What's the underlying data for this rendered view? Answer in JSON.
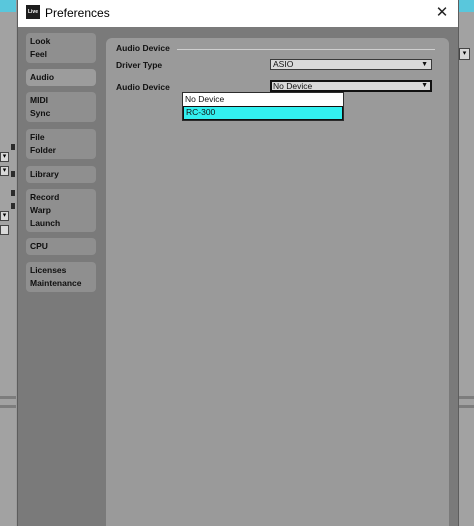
{
  "window": {
    "app_logo": "Live",
    "title": "Preferences",
    "close_glyph": "✕"
  },
  "sidebar": {
    "tabs": [
      {
        "lines": [
          "Look",
          "Feel"
        ],
        "active": false
      },
      {
        "lines": [
          "Audio"
        ],
        "active": true
      },
      {
        "lines": [
          "MIDI",
          "Sync"
        ],
        "active": false
      },
      {
        "lines": [
          "File",
          "Folder"
        ],
        "active": false
      },
      {
        "lines": [
          "Library"
        ],
        "active": false
      },
      {
        "lines": [
          "Record",
          "Warp",
          "Launch"
        ],
        "active": false
      },
      {
        "lines": [
          "CPU"
        ],
        "active": false
      },
      {
        "lines": [
          "Licenses",
          "Maintenance"
        ],
        "active": false
      }
    ]
  },
  "audio": {
    "section_title": "Audio Device",
    "driver_type": {
      "label": "Driver Type",
      "value": "ASIO"
    },
    "audio_device": {
      "label": "Audio Device",
      "value": "No Device",
      "options": [
        "No Device",
        "RC-300"
      ],
      "highlighted": "RC-300"
    }
  },
  "background": {
    "control_glyph": "▾"
  },
  "colors": {
    "highlight": "#33f0f0",
    "window_bg": "#7a7a7a",
    "panel_bg": "#9a9a9a",
    "accent_cyan": "#59c7dc"
  }
}
